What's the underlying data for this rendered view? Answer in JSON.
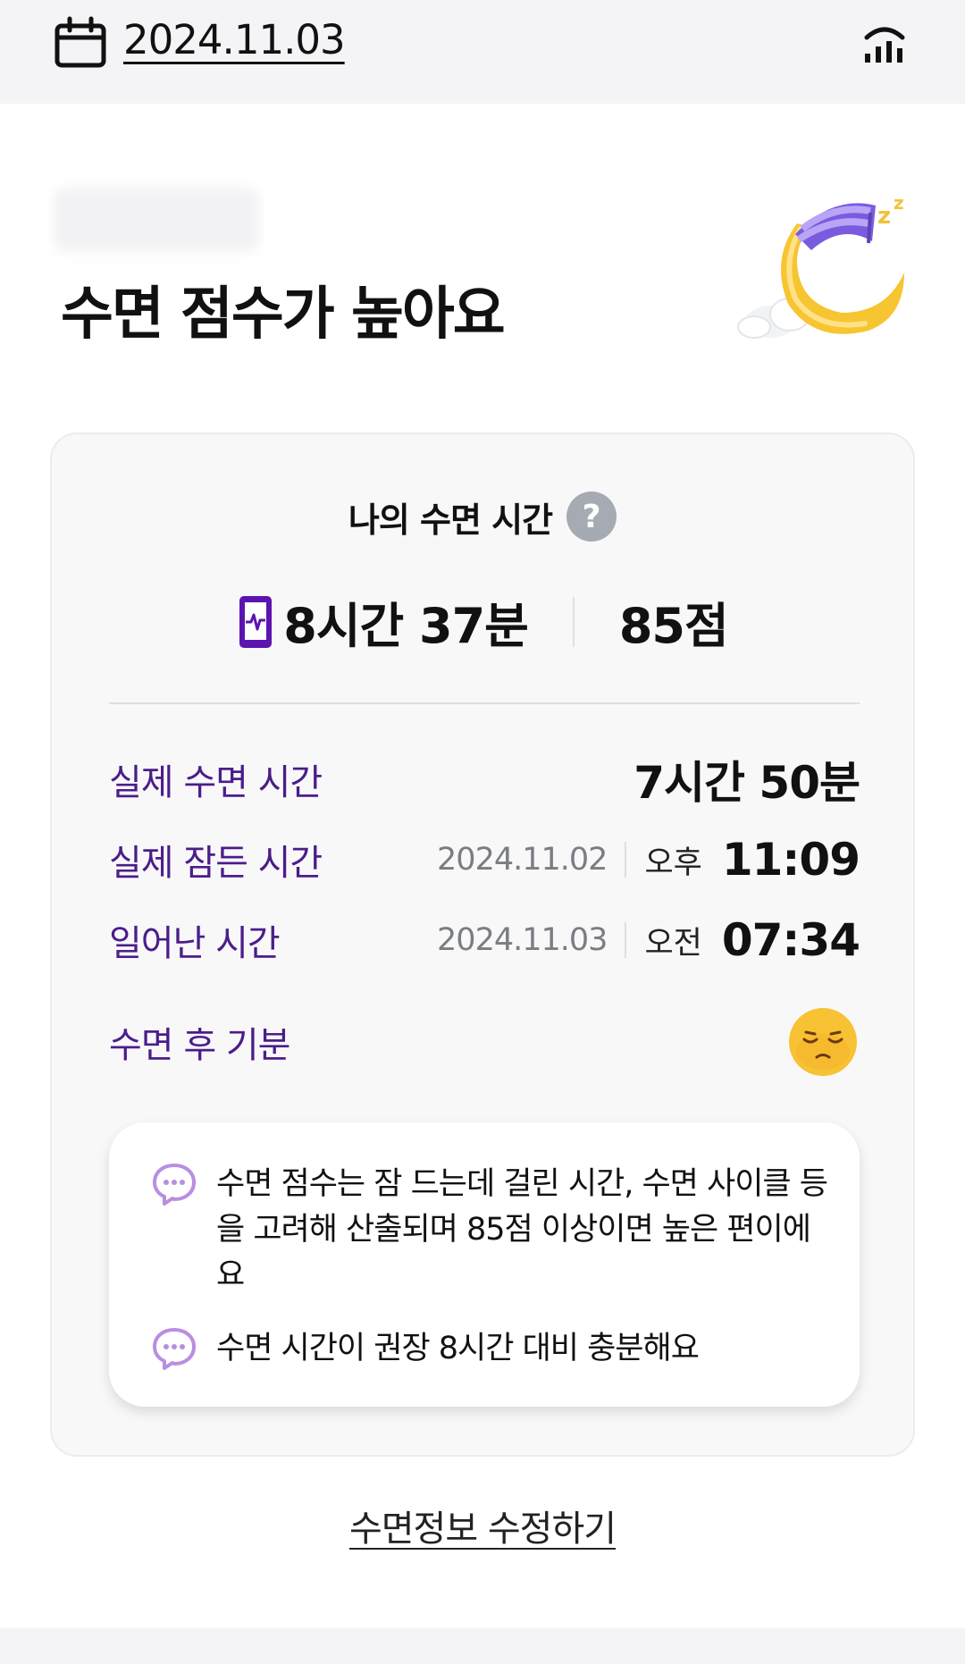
{
  "header": {
    "date": "2024.11.03",
    "calendar_icon": "calendar-icon",
    "stats_icon": "bar-chart-icon"
  },
  "hero": {
    "title": "수면 점수가 높아요",
    "illustration": "sleeping-moon-illustration"
  },
  "card": {
    "title": "나의 수면 시간",
    "help_icon": "question-icon",
    "help_glyph": "?",
    "summary": {
      "device_icon": "phone-heartbeat-icon",
      "duration": "8시간 37분",
      "score": "85점"
    },
    "rows": {
      "actual_sleep": {
        "label": "실제 수면 시간",
        "value": "7시간 50분"
      },
      "fell_asleep": {
        "label": "실제 잠든 시간",
        "date": "2024.11.02",
        "ampm": "오후",
        "time": "11:09"
      },
      "woke_up": {
        "label": "일어난 시간",
        "date": "2024.11.03",
        "ampm": "오전",
        "time": "07:34"
      },
      "mood": {
        "label": "수면 후 기분",
        "emoji": "sleepy-face-emoji"
      }
    },
    "info": [
      {
        "icon": "chat-bubble-icon",
        "text": "수면 점수는 잠 드는데 걸린 시간, 수면 사이클 등을 고려해 산출되며 85점 이상이면 높은 편이에요"
      },
      {
        "icon": "chat-bubble-icon",
        "text": "수면 시간이 권장 8시간 대비 충분해요"
      }
    ]
  },
  "edit_link": "수면정보 수정하기",
  "colors": {
    "accent_purple": "#4b1d8a",
    "device_purple": "#5b14b0",
    "chat_icon": "#b98ee0",
    "muted_text": "#7a7d83"
  }
}
